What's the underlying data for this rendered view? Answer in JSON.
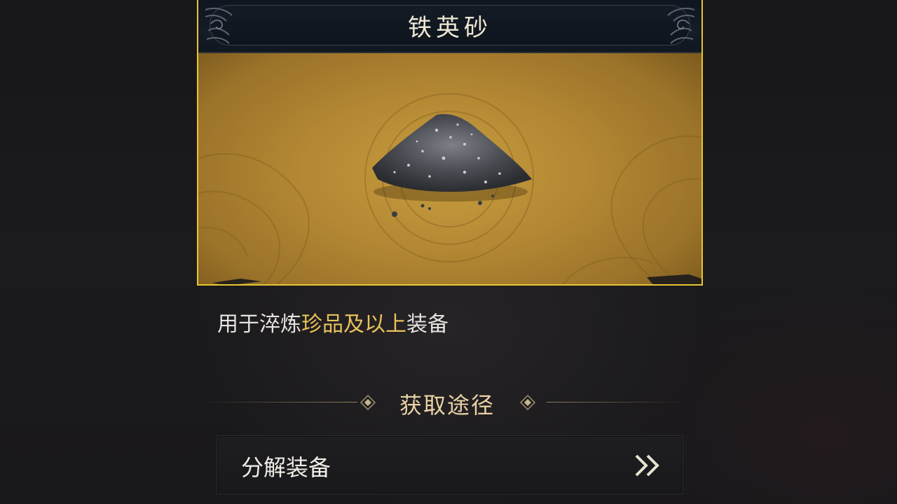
{
  "item": {
    "name": "铁英砂",
    "frame_color": "#e7c530"
  },
  "description": {
    "prefix": "用于淬炼",
    "highlight": "珍品及以上",
    "suffix": "装备",
    "highlight_color": "#e9c25a"
  },
  "acquisition": {
    "section_title": "获取途径",
    "sources": [
      {
        "label": "分解装备",
        "icon": "double-chevron-right-icon"
      }
    ]
  }
}
